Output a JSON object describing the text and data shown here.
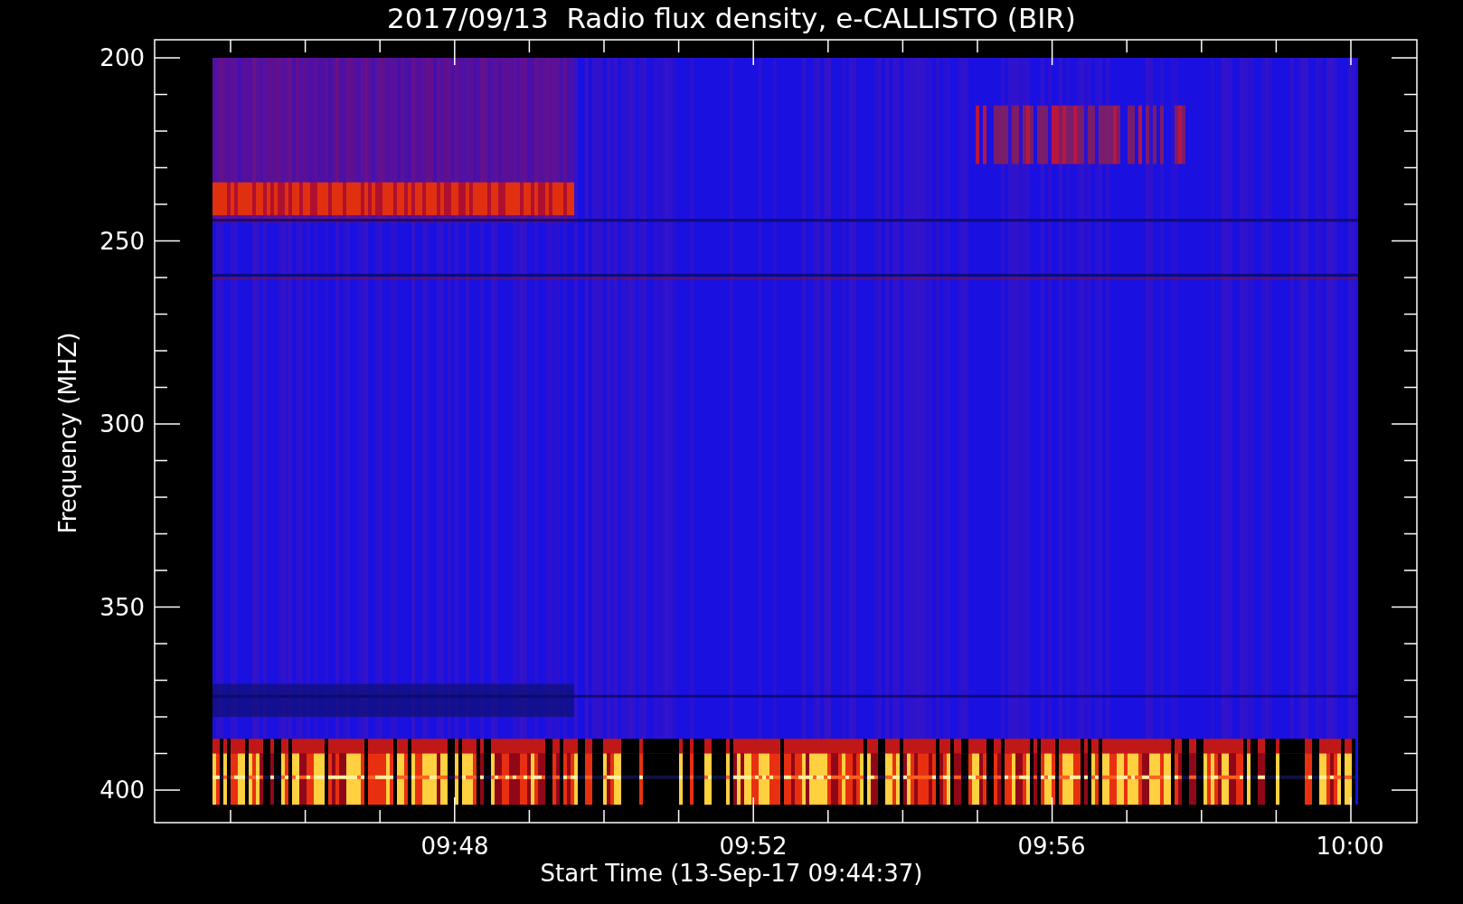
{
  "title": "2017/09/13  Radio flux density, e-CALLISTO (BIR)",
  "y_axis": {
    "label": "Frequency (MHZ)",
    "ticks": [
      "200",
      "250",
      "300",
      "350",
      "400"
    ]
  },
  "x_axis": {
    "label": "Start Time (13-Sep-17 09:44:37)",
    "ticks": [
      "09:48",
      "09:52",
      "09:56",
      "10:00"
    ]
  }
}
